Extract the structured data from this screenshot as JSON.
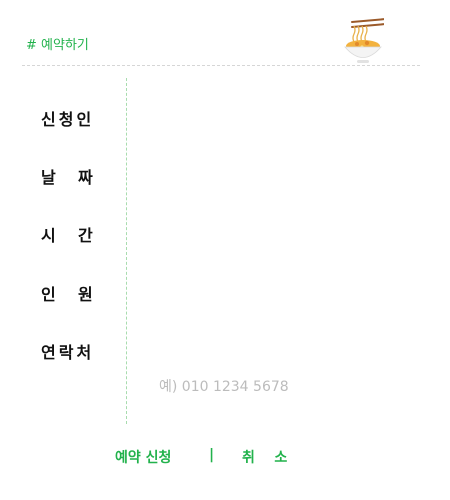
{
  "header": {
    "title": "# 예약하기",
    "icon": "noodle-bowl-icon"
  },
  "form": {
    "labels": {
      "name": "신청인",
      "date": "날    짜",
      "time": "시    간",
      "people": "인    원",
      "contact": "연락처"
    },
    "contact_placeholder": "예) 010 1234 5678"
  },
  "actions": {
    "submit": "예약 신청",
    "separator": "|",
    "cancel": "취    소"
  },
  "colors": {
    "accent": "#22b24c",
    "placeholder": "#bcbcbc"
  }
}
